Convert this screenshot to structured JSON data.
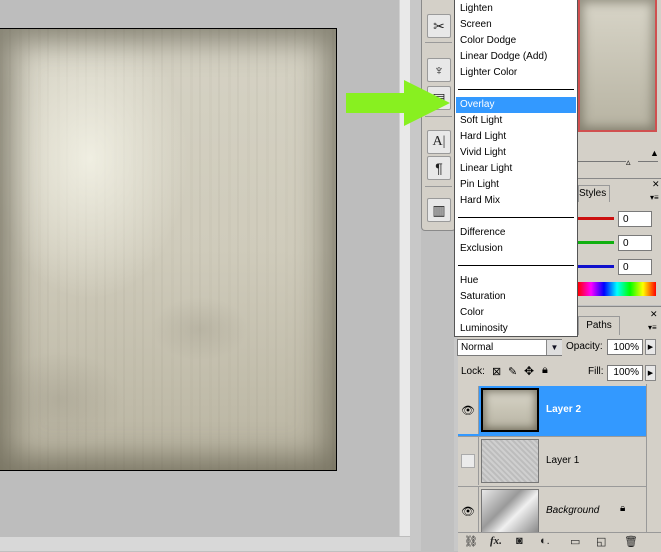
{
  "blend_menu": {
    "groups": [
      [
        "Lighten",
        "Screen",
        "Color Dodge",
        "Linear Dodge (Add)",
        "Lighter Color"
      ],
      [
        "Overlay",
        "Soft Light",
        "Hard Light",
        "Vivid Light",
        "Linear Light",
        "Pin Light",
        "Hard Mix"
      ],
      [
        "Difference",
        "Exclusion"
      ],
      [
        "Hue",
        "Saturation",
        "Color",
        "Luminosity"
      ]
    ],
    "selected": "Overlay"
  },
  "color_panel": {
    "styles_tab": "Styles",
    "values": [
      "0",
      "0",
      "0"
    ],
    "bar_colors": [
      "#cc1010",
      "#10b010",
      "#1010cc"
    ]
  },
  "layers_panel": {
    "paths_tab": "Paths",
    "blend_mode": "Normal",
    "opacity_label": "Opacity:",
    "opacity_value": "100%",
    "lock_label": "Lock:",
    "fill_label": "Fill:",
    "fill_value": "100%",
    "layers": [
      {
        "name": "Layer 2",
        "visible": true,
        "selected": true
      },
      {
        "name": "Layer 1",
        "visible": false,
        "selected": false
      },
      {
        "name": "Background",
        "visible": true,
        "selected": false,
        "locked": true
      }
    ]
  },
  "colors": {
    "selection": "#3399ff",
    "arrow": "#88f020"
  }
}
